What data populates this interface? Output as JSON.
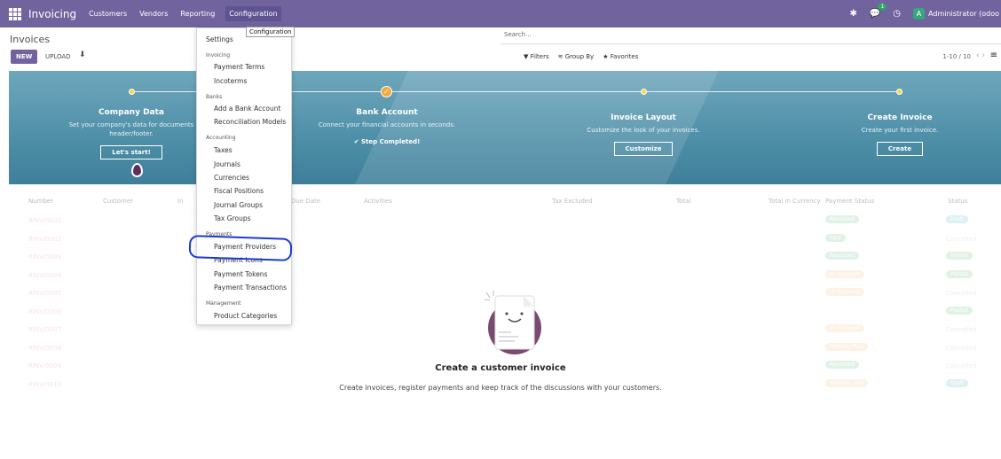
{
  "navbar": {
    "app_name": "Invoicing",
    "menu": [
      "Customers",
      "Vendors",
      "Reporting",
      "Configuration"
    ],
    "chat_badge": "1",
    "avatar_letter": "A",
    "user": "Administrator (odoo"
  },
  "control": {
    "title": "Invoices",
    "new_label": "NEW",
    "upload_label": "UPLOAD",
    "search_placeholder": "Search...",
    "filters_label": "Filters",
    "groupby_label": "Group By",
    "favorites_label": "Favorites",
    "pager": "1-10 / 10"
  },
  "onboarding": {
    "steps": [
      {
        "title": "Company Data",
        "text": "Set your company's data for documents header/footer.",
        "button": "Let's start!"
      },
      {
        "title": "Bank Account",
        "text": "Connect your financial accounts in seconds.",
        "done": "Step Completed!"
      },
      {
        "title": "Invoice Layout",
        "text": "Customize the look of your invoices.",
        "button": "Customize"
      },
      {
        "title": "Create Invoice",
        "text": "Create your first invoice.",
        "button": "Create"
      }
    ]
  },
  "table": {
    "headers": [
      "Number",
      "Customer",
      "In",
      "Due Date",
      "Activities",
      "Tax Excluded",
      "Total",
      "Total in Currency",
      "Payment Status",
      "Status"
    ],
    "rows": [
      {
        "number": "RINV/0001",
        "payment": "Reversed",
        "status": "Draft"
      },
      {
        "number": "RINV/0002",
        "payment": "Paid",
        "status": "Cancelled"
      },
      {
        "number": "RINV/0003",
        "payment": "Reversed",
        "status": "Posted"
      },
      {
        "number": "RINV/0004",
        "payment": "In Payment",
        "status": "Posted"
      },
      {
        "number": "RINV/0005",
        "payment": "In Payment",
        "status": "Cancelled"
      },
      {
        "number": "RINV/0006",
        "payment": "",
        "status": "Posted"
      },
      {
        "number": "RINV/0007",
        "payment": "In Payment",
        "status": "Cancelled"
      },
      {
        "number": "RINV/0008",
        "payment": "Partially Paid",
        "status": "Cancelled"
      },
      {
        "number": "RINV/0009",
        "payment": "Reversed",
        "status": "Cancelled"
      },
      {
        "number": "RINV/0010",
        "payment": "Partially Paid",
        "status": "Draft"
      }
    ]
  },
  "empty_state": {
    "title": "Create a customer invoice",
    "text": "Create invoices, register payments and keep track of the discussions with your customers."
  },
  "dropdown": {
    "tooltip": "Configuration",
    "settings": "Settings",
    "sections": {
      "invoicing": "Invoicing",
      "banks": "Banks",
      "accounting": "Accounting",
      "payments": "Payments",
      "management": "Management"
    },
    "items": {
      "payment_terms": "Payment Terms",
      "incoterms": "Incoterms",
      "add_bank_account": "Add a Bank Account",
      "reconciliation_models": "Reconciliation Models",
      "taxes": "Taxes",
      "journals": "Journals",
      "currencies": "Currencies",
      "fiscal_positions": "Fiscal Positions",
      "journal_groups": "Journal Groups",
      "tax_groups": "Tax Groups",
      "payment_providers": "Payment Providers",
      "payment_icons": "Payment Icons",
      "payment_tokens": "Payment Tokens",
      "payment_transactions": "Payment Transactions",
      "product_categories": "Product Categories"
    }
  },
  "colors": {
    "navbar": "#71639e",
    "annotation": "#1b3bd3",
    "reversed": "#27ae60",
    "in_payment": "#f0ad4e",
    "draft": "#17a2b8",
    "posted": "#28a745"
  }
}
